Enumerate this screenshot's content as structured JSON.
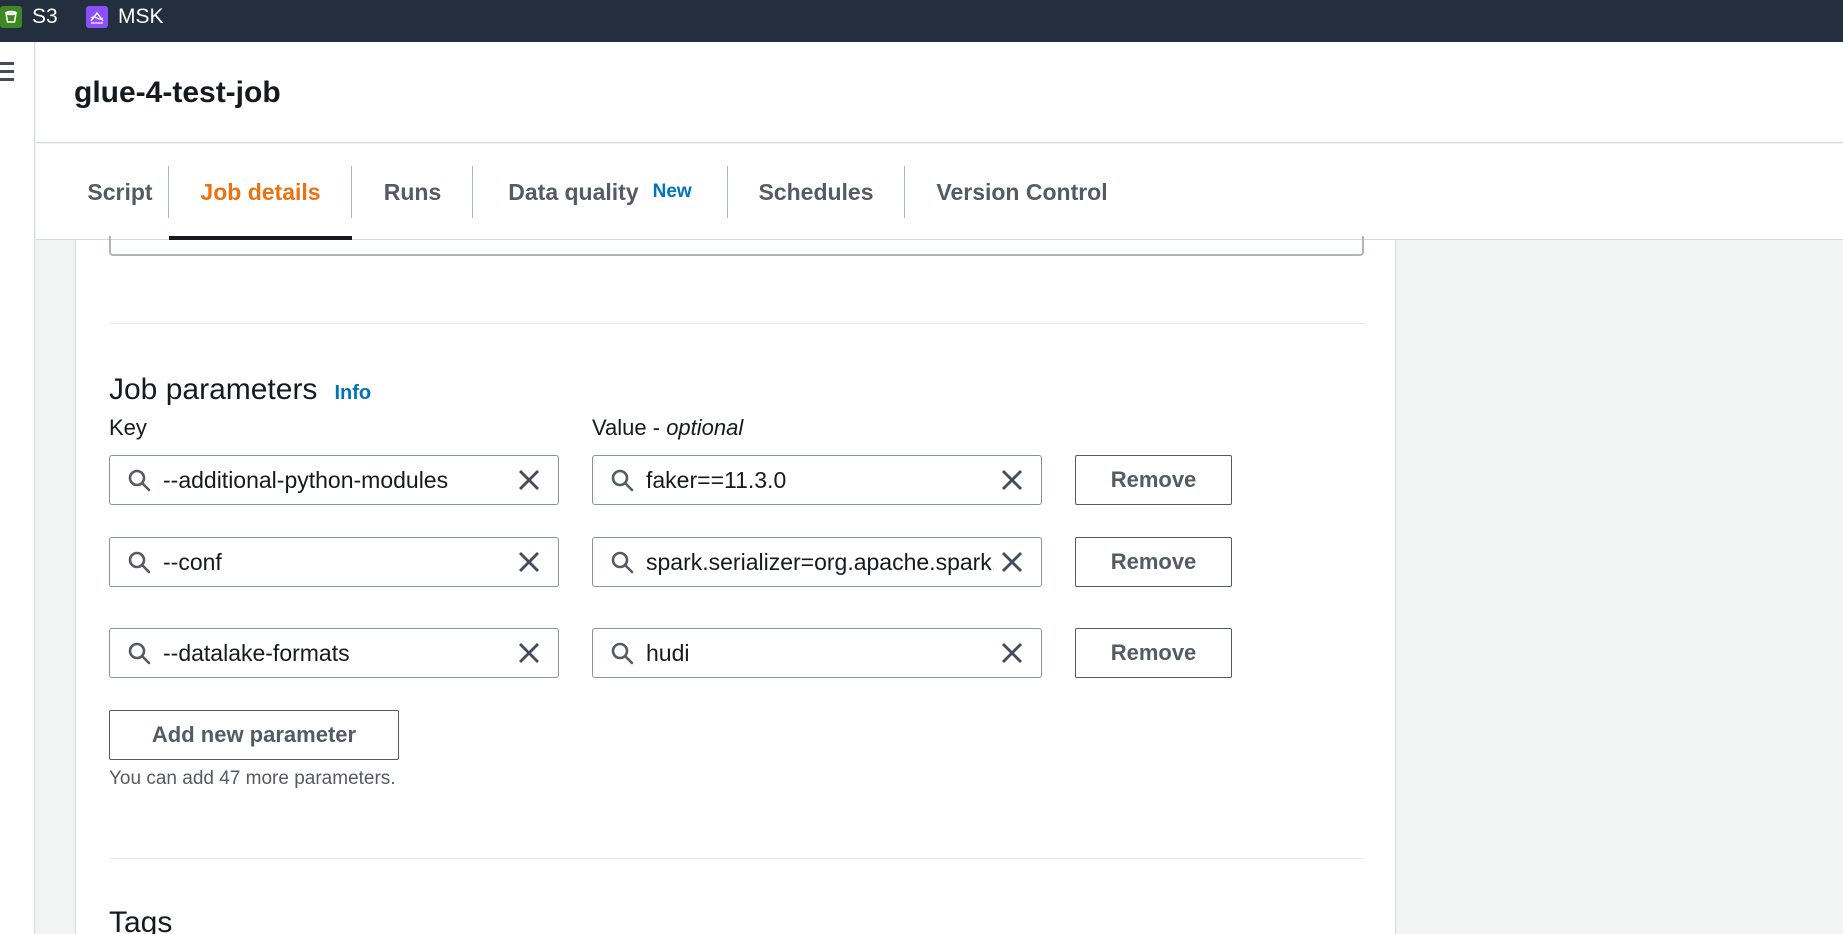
{
  "topbar": {
    "services": [
      {
        "label": "S3",
        "icon": "s3-bucket-icon",
        "color": "#3f8624"
      },
      {
        "label": "MSK",
        "icon": "msk-stream-icon",
        "color": "#8c4fff"
      }
    ]
  },
  "header": {
    "title": "glue-4-test-job"
  },
  "tabs": [
    {
      "label": "Script"
    },
    {
      "label": "Job details",
      "active": true
    },
    {
      "label": "Runs"
    },
    {
      "label": "Data quality",
      "badge": "New"
    },
    {
      "label": "Schedules"
    },
    {
      "label": "Version Control"
    }
  ],
  "job_parameters": {
    "title": "Job parameters",
    "info": "Info",
    "key_label": "Key",
    "value_label": "Value - ",
    "value_label_optional": "optional",
    "rows": [
      {
        "key": "--additional-python-modules",
        "value": "faker==11.3.0",
        "remove": "Remove"
      },
      {
        "key": "--conf",
        "value": "spark.serializer=org.apache.spark.serializer.KryoSerializer",
        "remove": "Remove"
      },
      {
        "key": "--datalake-formats",
        "value": "hudi",
        "remove": "Remove"
      }
    ],
    "add_button": "Add new parameter",
    "hint": "You can add 47 more parameters."
  },
  "tags": {
    "title": "Tags"
  },
  "colors": {
    "accent": "#ec7211",
    "link": "#0073bb",
    "topbar": "#232f3e"
  }
}
